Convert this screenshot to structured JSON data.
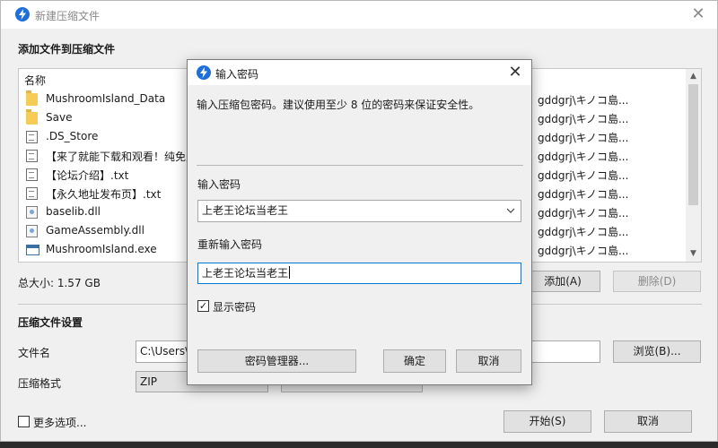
{
  "window": {
    "title": "新建压缩文件",
    "close_glyph": "✕"
  },
  "file_section": {
    "heading": "添加文件到压缩文件",
    "column_name": "名称",
    "files": [
      {
        "name": "MushroomIsland_Data",
        "icon": "folder-icon",
        "path": "gddgrj\\キノコ島..."
      },
      {
        "name": "Save",
        "icon": "folder-icon",
        "path": "gddgrj\\キノコ島..."
      },
      {
        "name": ".DS_Store",
        "icon": "file-icon",
        "path": "gddgrj\\キノコ島..."
      },
      {
        "name": "【来了就能下载和观看！纯免费",
        "icon": "text-file-icon",
        "path": "gddgrj\\キノコ島..."
      },
      {
        "name": "【论坛介绍】.txt",
        "icon": "text-file-icon",
        "path": "gddgrj\\キノコ島..."
      },
      {
        "name": "【永久地址发布页】.txt",
        "icon": "text-file-icon",
        "path": "gddgrj\\キノコ島..."
      },
      {
        "name": "baselib.dll",
        "icon": "dll-file-icon",
        "path": "gddgrj\\キノコ島..."
      },
      {
        "name": "GameAssembly.dll",
        "icon": "dll-file-icon",
        "path": "gddgrj\\キノコ島..."
      },
      {
        "name": "MushroomIsland.exe",
        "icon": "exe-file-icon",
        "path": "gddgrj\\キノコ島..."
      }
    ],
    "total_size": "总大小: 1.57 GB",
    "add_button": "添加(A)",
    "delete_button": "删除(D)"
  },
  "settings_section": {
    "heading": "压缩文件设置",
    "filename_label": "文件名",
    "filename_value": "C:\\Users\\",
    "browse_button": "浏览(B)...",
    "format_label": "压缩格式",
    "format_value": "ZIP"
  },
  "footer": {
    "more_options": "更多选项...",
    "start_button": "开始(S)",
    "cancel_button": "取消"
  },
  "password_dialog": {
    "title": "输入密码",
    "close_glyph": "✕",
    "description": "输入压缩包密码。建议使用至少 8 位的密码来保证安全性。",
    "password_label": "输入密码",
    "password_value": "上老王论坛当老王",
    "reenter_label": "重新输入密码",
    "reenter_value": "上老王论坛当老王",
    "show_password_label": "显示密码",
    "show_password_checked": true,
    "check_glyph": "✓",
    "manager_button": "密码管理器...",
    "ok_button": "确定",
    "cancel_button": "取消"
  },
  "colors": {
    "accent": "#0078d7",
    "app_icon": "#1e6fd9",
    "window_bg": "#f0f0f0"
  }
}
